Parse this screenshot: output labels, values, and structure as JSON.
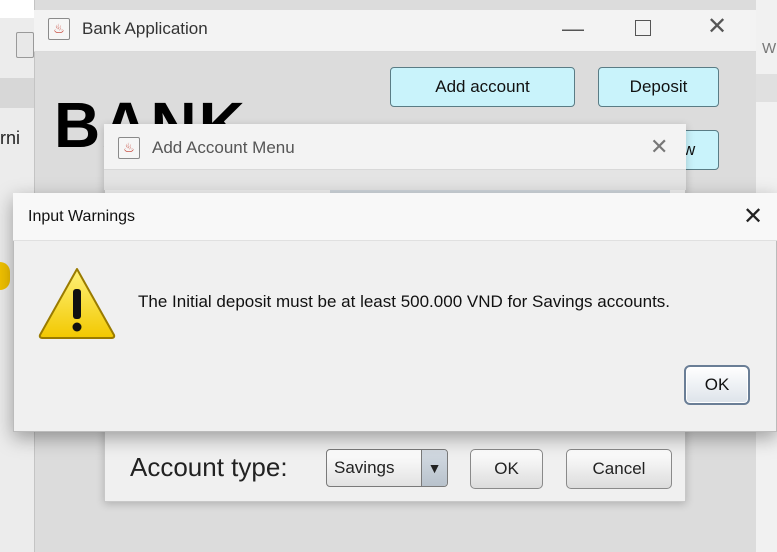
{
  "bank_window": {
    "title": "Bank Application",
    "heading": "BANK",
    "add_account_button": "Add account",
    "deposit_button": "Deposit",
    "partial_button": "w"
  },
  "add_account_dialog": {
    "title": "Add Account Menu",
    "account_type_label": "Account type:",
    "account_type_selected": "Savings",
    "ok_button": "OK",
    "cancel_button": "Cancel"
  },
  "warning_dialog": {
    "title": "Input Warnings",
    "message": "The Initial deposit must be at least 500.000 VND for Savings accounts.",
    "ok_button": "OK",
    "icon": "warning-icon"
  },
  "background": {
    "left_partial_text": "rni",
    "right_partial_text": "W"
  },
  "colors": {
    "button_cyan": "#c9f3fb",
    "warning_yellow": "#f5d90a",
    "dialog_bg": "#f0f0f0"
  }
}
